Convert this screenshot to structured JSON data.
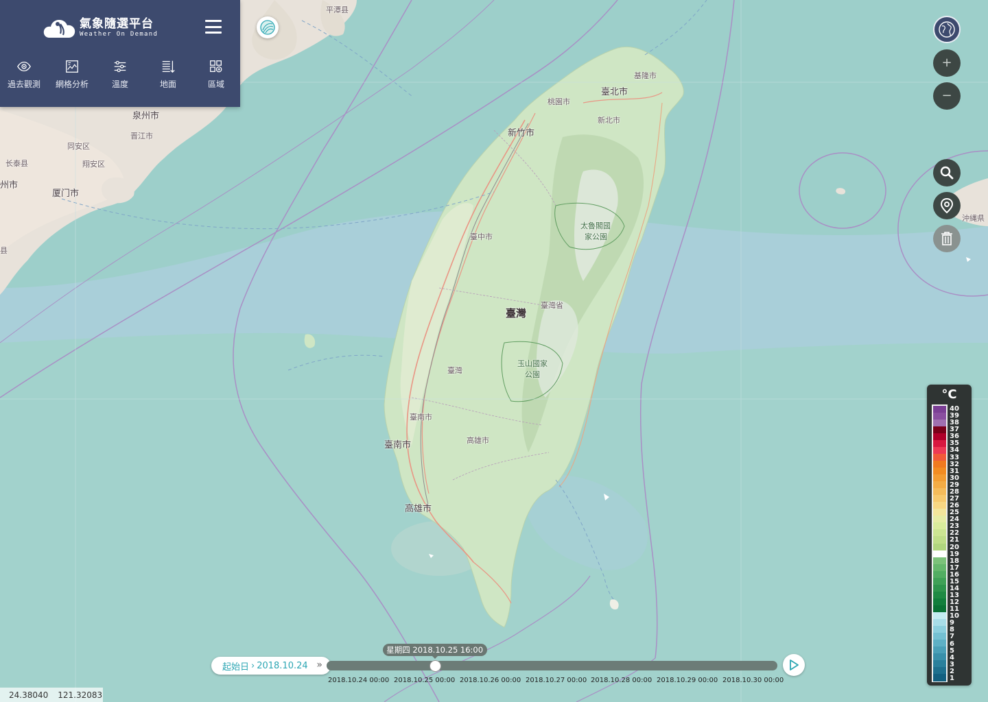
{
  "app": {
    "title_cn": "氣象隨選平台",
    "title_en": "Weather On Demand"
  },
  "toolbar": {
    "items": [
      {
        "label": "過去觀測",
        "icon": "eye-icon"
      },
      {
        "label": "網格分析",
        "icon": "chart-image-icon"
      },
      {
        "label": "溫度",
        "icon": "sliders-icon"
      },
      {
        "label": "地面",
        "icon": "list-layers-icon"
      },
      {
        "label": "區域",
        "icon": "grid-plus-icon"
      }
    ]
  },
  "map_labels": [
    {
      "text": "平潭县",
      "cls": "small"
    },
    {
      "text": "泉州市",
      "cls": "mid"
    },
    {
      "text": "晋江市",
      "cls": "small"
    },
    {
      "text": "同安区",
      "cls": "small"
    },
    {
      "text": "长泰县",
      "cls": "small"
    },
    {
      "text": "翔安区",
      "cls": "small"
    },
    {
      "text": "州市",
      "cls": "mid"
    },
    {
      "text": "厦门市",
      "cls": "mid"
    },
    {
      "text": "县",
      "cls": "small"
    },
    {
      "text": "基隆市",
      "cls": "small"
    },
    {
      "text": "臺北市",
      "cls": "mid"
    },
    {
      "text": "桃園市",
      "cls": "small"
    },
    {
      "text": "新北市",
      "cls": "small"
    },
    {
      "text": "新竹市",
      "cls": "mid"
    },
    {
      "text": "太魯閣國",
      "cls": "park"
    },
    {
      "text": "家公園",
      "cls": "park"
    },
    {
      "text": "臺中市",
      "cls": "small"
    },
    {
      "text": "臺灣",
      "cls": "big"
    },
    {
      "text": "臺灣省",
      "cls": "small"
    },
    {
      "text": "玉山國家",
      "cls": "park"
    },
    {
      "text": "公園",
      "cls": "park"
    },
    {
      "text": "臺灣",
      "cls": "small"
    },
    {
      "text": "臺南市",
      "cls": "small"
    },
    {
      "text": "臺南市",
      "cls": "mid"
    },
    {
      "text": "高雄市",
      "cls": "small"
    },
    {
      "text": "高雄市",
      "cls": "mid"
    },
    {
      "text": "沖縄県",
      "cls": "small"
    }
  ],
  "legend": {
    "unit": "°C",
    "ticks": [
      "40",
      "39",
      "38",
      "37",
      "36",
      "35",
      "34",
      "33",
      "32",
      "31",
      "30",
      "29",
      "28",
      "27",
      "26",
      "25",
      "24",
      "23",
      "22",
      "21",
      "20",
      "19",
      "18",
      "17",
      "16",
      "15",
      "14",
      "13",
      "12",
      "11",
      "10",
      "9",
      "8",
      "7",
      "6",
      "5",
      "4",
      "3",
      "2",
      "1"
    ],
    "colors": [
      "#7b3f95",
      "#8a4fa0",
      "#a070b0",
      "#7a0019",
      "#b0002a",
      "#d81840",
      "#ee3a55",
      "#f25a3a",
      "#f07a20",
      "#f28c22",
      "#f39d33",
      "#f4ac45",
      "#f5bb5a",
      "#f7c96e",
      "#f8d783",
      "#f3e59b",
      "#e6eca4",
      "#d9ec9c",
      "#cce592",
      "#bfde88",
      "#b0d67e",
      "#ffffff",
      "#7cc27a",
      "#66b86d",
      "#52ad62",
      "#40a157",
      "#2f954d",
      "#1f8a44",
      "#127e3c",
      "#0a7235",
      "#c4ecf1",
      "#a8dde8",
      "#8ccfde",
      "#74c0d2",
      "#5eb0c5",
      "#4aa0b8",
      "#3990aa",
      "#2a809c",
      "#1e708e",
      "#136080"
    ]
  },
  "timeline": {
    "start_label": "起始日",
    "start_sep": "›",
    "start_date": "2018.10.24",
    "current_tooltip": "星期四 2018.10.25 16:00",
    "current_position": 0.24,
    "labels": [
      "2018.10.24 00:00",
      "2018.10.25 00:00",
      "2018.10.26 00:00",
      "2018.10.27 00:00",
      "2018.10.28 00:00",
      "2018.10.29 00:00",
      "2018.10.30 00:00"
    ]
  },
  "coords": {
    "lat": "24.38040",
    "lon": "121.32083"
  },
  "colors": {
    "panel": "#3d4a6e",
    "accent": "#2ca6b3",
    "sea": "#a9cfd9",
    "land": "#d7e9cd"
  }
}
